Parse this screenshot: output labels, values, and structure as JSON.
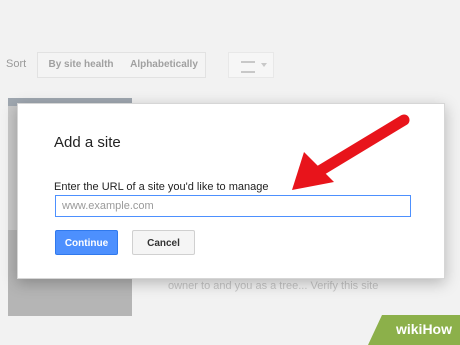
{
  "sort_bar": {
    "label": "Sort",
    "by_site_health": "By site health",
    "alphabetically": "Alphabetically"
  },
  "background": {
    "hint_text": "owner to and you as a tree... Verify this site"
  },
  "dialog": {
    "title": "Add a site",
    "url_label": "Enter the URL of a site you'd like to manage",
    "url_placeholder": "www.example.com",
    "continue_label": "Continue",
    "cancel_label": "Cancel"
  },
  "colors": {
    "primary_button": "#4d90fe",
    "arrow": "#e8141b",
    "badge_green": "#8cb04a"
  },
  "watermark": {
    "wiki": "wiki",
    "how": "How"
  }
}
